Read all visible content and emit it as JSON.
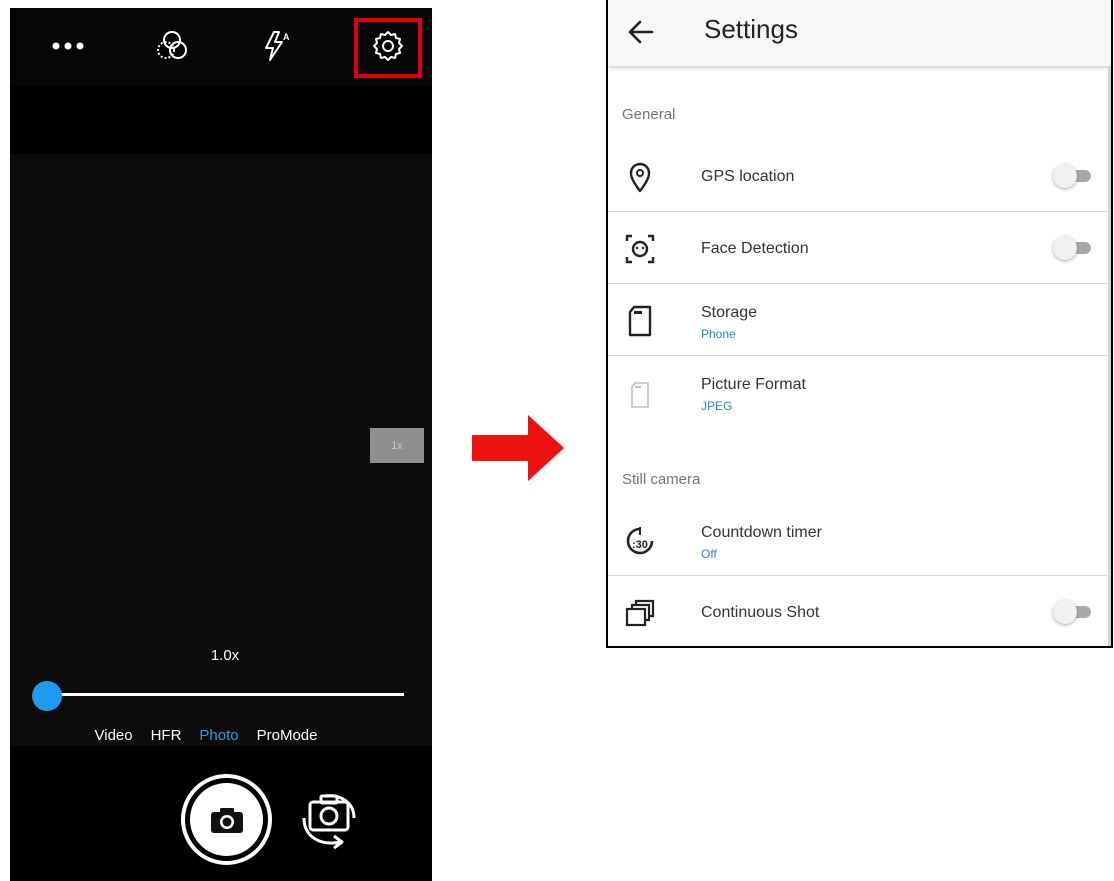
{
  "camera": {
    "top_bar": {
      "icons": [
        "more-icon",
        "color-filter-icon",
        "flash-auto-icon",
        "settings-gear-icon"
      ]
    },
    "zoom_badge": "1x",
    "zoom_level": "1.0x",
    "zoom_slider_value": 0,
    "modes": [
      "Video",
      "HFR",
      "Photo",
      "ProMode"
    ],
    "active_mode": "Photo",
    "accent_color": "#2b9de8",
    "highlight_color": "#e10000"
  },
  "arrow_color": "#ee1111",
  "settings": {
    "title": "Settings",
    "sections": {
      "general": "General",
      "still_camera": "Still camera"
    },
    "rows": {
      "gps": {
        "title": "GPS location",
        "icon": "location-pin-icon",
        "toggle": "off"
      },
      "face": {
        "title": "Face Detection",
        "icon": "face-detection-icon",
        "toggle": "off"
      },
      "storage": {
        "title": "Storage",
        "subtitle": "Phone",
        "icon": "sd-card-icon"
      },
      "picture_format": {
        "title": "Picture Format",
        "subtitle": "JPEG",
        "icon": "sd-card-outline-icon"
      },
      "countdown": {
        "title": "Countdown timer",
        "subtitle": "Off",
        "icon": "timer-30-icon"
      },
      "continuous": {
        "title": "Continuous Shot",
        "icon": "burst-shot-icon",
        "toggle": "off"
      }
    },
    "subtitle_color": "#2f80d5"
  }
}
